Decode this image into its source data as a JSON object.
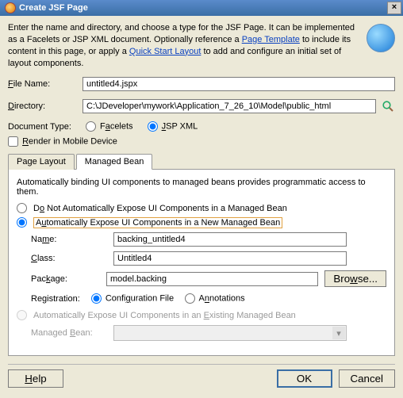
{
  "title": "Create JSF Page",
  "intro": {
    "p1a": "Enter the name and directory, and choose a type for the JSF Page. It can be implemented as a Facelets or JSP XML document. Optionally reference a ",
    "link1": "Page Template",
    "p1b": " to include its content in this page, or apply a ",
    "link2": "Quick Start Layout",
    "p1c": " to add and configure an initial set of layout components."
  },
  "labels": {
    "file_name": "File Name:",
    "directory": "Directory:",
    "doc_type": "Document Type:",
    "facelets": "Facelets",
    "jspxml": "JSP XML",
    "render_mobile": "Render in Mobile Device",
    "tab_page_layout": "Page Layout",
    "tab_managed_bean": "Managed Bean",
    "auto_bind_desc": "Automatically binding UI components to managed beans provides programmatic access to them.",
    "opt_no_expose": "Do Not Automatically Expose UI Components in a Managed Bean",
    "opt_auto_new": "Automatically Expose UI Components in a New Managed Bean",
    "name": "Name:",
    "class": "Class:",
    "package": "Package:",
    "browse": "Browse...",
    "registration": "Registration:",
    "reg_config": "Configuration File",
    "reg_anno": "Annotations",
    "opt_auto_existing": "Automatically Expose UI Components in an Existing Managed Bean",
    "managed_bean": "Managed Bean:",
    "help": "Help",
    "ok": "OK",
    "cancel": "Cancel"
  },
  "values": {
    "file_name": "untitled4.jspx",
    "directory": "C:\\JDeveloper\\mywork\\Application_7_26_10\\Model\\public_html",
    "doc_type_selected": "jspxml",
    "render_mobile": false,
    "active_tab": "managed_bean",
    "expose_option": "auto_new",
    "bean_name": "backing_untitled4",
    "bean_class": "Untitled4",
    "bean_package": "model.backing",
    "registration": "config"
  }
}
